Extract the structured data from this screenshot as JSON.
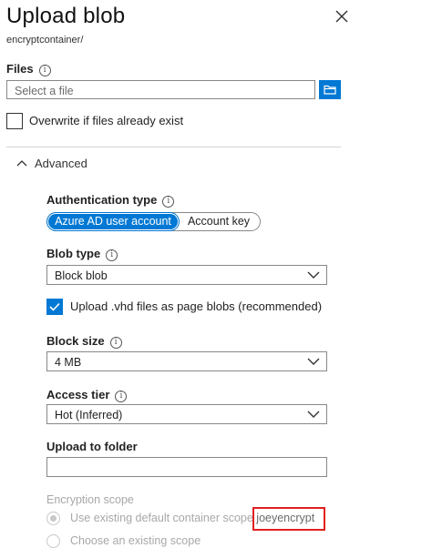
{
  "header": {
    "title": "Upload blob",
    "subtitle": "encryptcontainer/"
  },
  "files": {
    "label": "Files",
    "placeholder": "Select a file"
  },
  "overwrite": {
    "label": "Overwrite if files already exist",
    "checked": false
  },
  "advanced": {
    "label": "Advanced",
    "expanded": true
  },
  "auth": {
    "label": "Authentication type",
    "options": [
      "Azure AD user account",
      "Account key"
    ],
    "selected": "Azure AD user account"
  },
  "blob_type": {
    "label": "Blob type",
    "value": "Block blob"
  },
  "vhd": {
    "label": "Upload .vhd files as page blobs (recommended)",
    "checked": true
  },
  "block_size": {
    "label": "Block size",
    "value": "4 MB"
  },
  "access_tier": {
    "label": "Access tier",
    "value": "Hot (Inferred)"
  },
  "upload_folder": {
    "label": "Upload to folder",
    "value": ""
  },
  "encryption": {
    "label": "Encryption scope",
    "option_default": "Use existing default container scope",
    "default_scope_value": "joeyencrypt",
    "option_existing": "Choose an existing scope"
  },
  "colors": {
    "accent": "#0078d4",
    "highlight": "#e0201f"
  }
}
